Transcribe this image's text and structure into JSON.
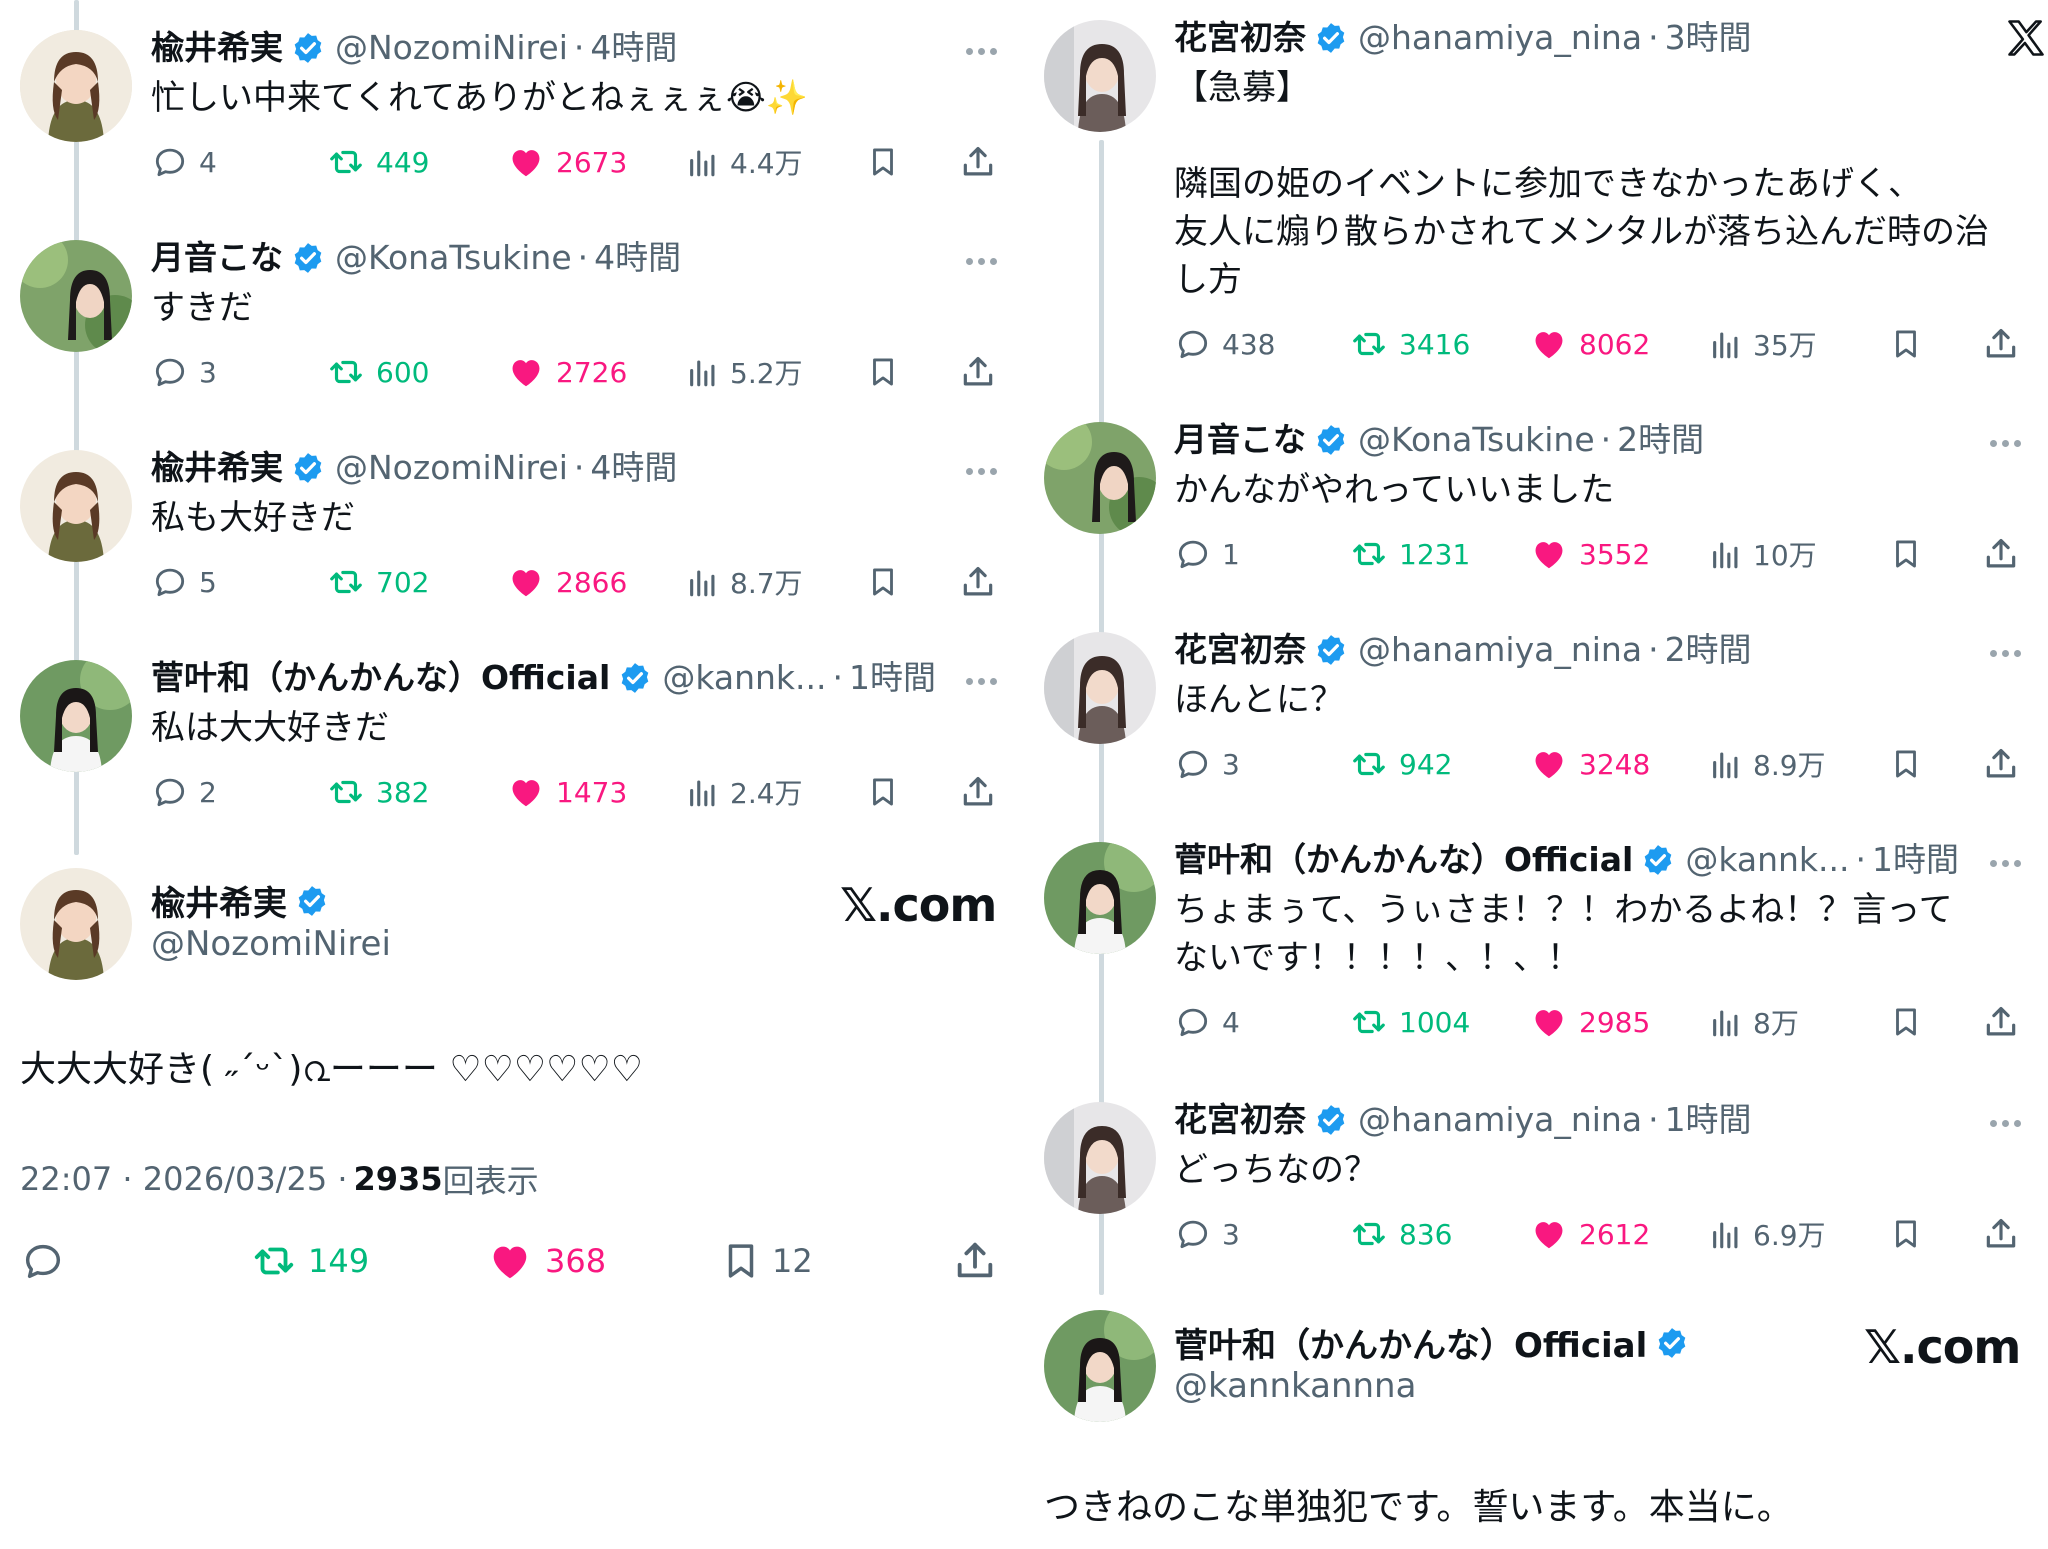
{
  "left": {
    "tweets": [
      {
        "name": "楡井希実",
        "handle": "@NozomiNirei",
        "time": "4時間",
        "text": "忙しい中来てくれてありがとねぇぇぇ😭✨",
        "reply": "4",
        "retweet": "449",
        "like": "2673",
        "views": "4.4万"
      },
      {
        "name": "月音こな",
        "handle": "@KonaTsukine",
        "time": "4時間",
        "text": "すきだ",
        "reply": "3",
        "retweet": "600",
        "like": "2726",
        "views": "5.2万"
      },
      {
        "name": "楡井希実",
        "handle": "@NozomiNirei",
        "time": "4時間",
        "text": "私も大好きだ",
        "reply": "5",
        "retweet": "702",
        "like": "2866",
        "views": "8.7万"
      },
      {
        "name": "菅叶和（かんかんな）Official",
        "handle": "@kannk...",
        "time": "1時間",
        "text": "私は大大好きだ",
        "reply": "2",
        "retweet": "382",
        "like": "1473",
        "views": "2.4万"
      }
    ],
    "main": {
      "name": "楡井希実",
      "handle": "@NozomiNirei",
      "xcom": "𝕏.com",
      "text": "大大大好き( ˶ˊᵕˋ)൨ーーー ♡♡♡♡♡♡",
      "footer_time": "22:07 · 2026/03/25 ·",
      "footer_views": "2935",
      "footer_views_label": "回表示",
      "retweet": "149",
      "like": "368",
      "bookmark": "12"
    }
  },
  "right": {
    "tweets": [
      {
        "name": "花宮初奈",
        "handle": "@hanamiya_nina",
        "time": "3時間",
        "text": "【急募】\n\n隣国の姫のイベントに参加できなかったあげく、\n友人に煽り散らかされてメンタルが落ち込んだ時の治\nし方",
        "reply": "438",
        "retweet": "3416",
        "like": "8062",
        "views": "35万"
      },
      {
        "name": "月音こな",
        "handle": "@KonaTsukine",
        "time": "2時間",
        "text": "かんながやれっていいました",
        "reply": "1",
        "retweet": "1231",
        "like": "3552",
        "views": "10万"
      },
      {
        "name": "花宮初奈",
        "handle": "@hanamiya_nina",
        "time": "2時間",
        "text": "ほんとに？",
        "reply": "3",
        "retweet": "942",
        "like": "3248",
        "views": "8.9万"
      },
      {
        "name": "菅叶和（かんかんな）Official",
        "handle": "@kannk...",
        "time": "1時間",
        "text": "ちょまぅて、うぃさま！？！わかるよね！？言って\nないです！！！！、！、！",
        "reply": "4",
        "retweet": "1004",
        "like": "2985",
        "views": "8万"
      },
      {
        "name": "花宮初奈",
        "handle": "@hanamiya_nina",
        "time": "1時間",
        "text": "どっちなの？",
        "reply": "3",
        "retweet": "836",
        "like": "2612",
        "views": "6.9万"
      }
    ],
    "main": {
      "name": "菅叶和（かんかんな）Official",
      "handle": "@kannkannna",
      "xcom": "𝕏.com",
      "text": "つきねのこな単独犯です。誓います。本当に。"
    }
  },
  "icons": {
    "verified": "verified-badge-icon",
    "reply": "reply-icon",
    "retweet": "retweet-icon",
    "like": "heart-icon",
    "views": "views-icon",
    "bookmark": "bookmark-icon",
    "share": "share-icon",
    "more": "more-icon",
    "x_logo": "x-logo-icon"
  },
  "colors": {
    "verified": "#1d9bf0",
    "retweet": "#00ba7c",
    "like": "#f91880",
    "muted": "#536471",
    "text": "#0f1419"
  }
}
